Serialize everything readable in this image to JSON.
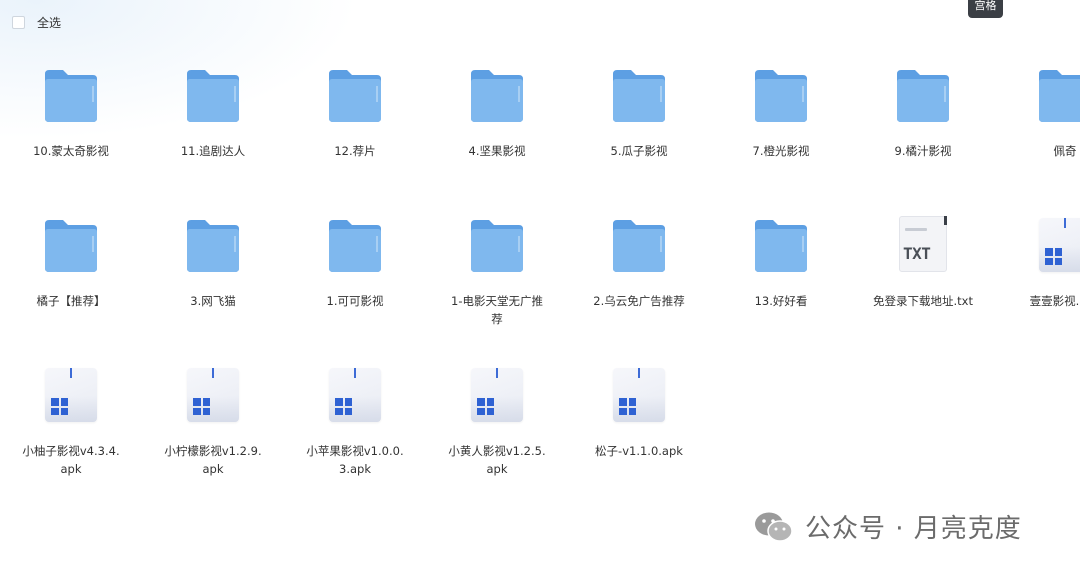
{
  "toolbar": {
    "select_all_label": "全选"
  },
  "tooltip": {
    "text": "宫格"
  },
  "files": [
    {
      "name": "10.蒙太奇影视",
      "type": "folder"
    },
    {
      "name": "11.追剧达人",
      "type": "folder"
    },
    {
      "name": "12.荐片",
      "type": "folder"
    },
    {
      "name": "4.坚果影视",
      "type": "folder"
    },
    {
      "name": "5.瓜子影视",
      "type": "folder"
    },
    {
      "name": "7.橙光影视",
      "type": "folder"
    },
    {
      "name": "9.橘汁影视",
      "type": "folder"
    },
    {
      "name": "佩奇",
      "type": "folder"
    },
    {
      "name": "橘子【推荐】",
      "type": "folder"
    },
    {
      "name": "3.网飞猫",
      "type": "folder"
    },
    {
      "name": "1.可可影视",
      "type": "folder"
    },
    {
      "name": "1-电影天堂无广推荐",
      "type": "folder"
    },
    {
      "name": "2.乌云免广告推荐",
      "type": "folder"
    },
    {
      "name": "13.好好看",
      "type": "folder"
    },
    {
      "name": "免登录下载地址.txt",
      "type": "txt"
    },
    {
      "name": "壹壹影视.apk",
      "type": "apk"
    },
    {
      "name": "小柚子影视v4.3.4.apk",
      "type": "apk"
    },
    {
      "name": "小柠檬影视v1.2.9.apk",
      "type": "apk"
    },
    {
      "name": "小苹果影视v1.0.0.3.apk",
      "type": "apk"
    },
    {
      "name": "小黄人影视v1.2.5.apk",
      "type": "apk"
    },
    {
      "name": "松子-v1.1.0.apk",
      "type": "apk"
    }
  ],
  "txt_icon_label": "TXT",
  "watermark": {
    "text": "公众号 · 月亮克度"
  },
  "colors": {
    "folder": "#7fb8ee",
    "folder_dark": "#5d9fe3",
    "apk_logo": "#2f62d3"
  }
}
